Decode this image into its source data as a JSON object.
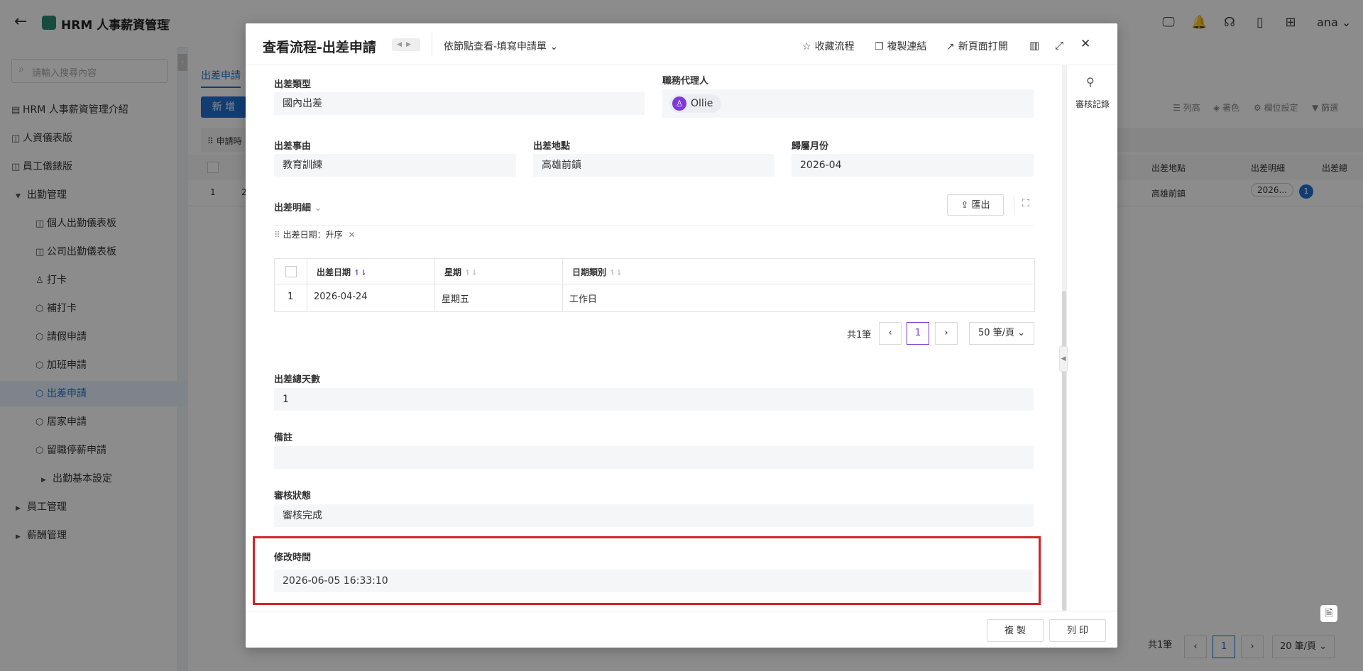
{
  "app": {
    "title": "HRM 人事薪資管理",
    "user": "ana"
  },
  "sidebar": {
    "search_placeholder": "請輸入搜尋內容",
    "items": [
      {
        "label": "HRM 人事薪資管理介紹"
      },
      {
        "label": "人資儀表版"
      },
      {
        "label": "員工儀錶版"
      },
      {
        "label": "出勤管理"
      },
      {
        "label": "個人出勤儀表板"
      },
      {
        "label": "公司出勤儀表板"
      },
      {
        "label": "打卡"
      },
      {
        "label": "補打卡"
      },
      {
        "label": "請假申請"
      },
      {
        "label": "加班申請"
      },
      {
        "label": "出差申請"
      },
      {
        "label": "居家申請"
      },
      {
        "label": "留職停薪申請"
      },
      {
        "label": "出勤基本設定"
      },
      {
        "label": "員工管理"
      },
      {
        "label": "薪酬管理"
      }
    ]
  },
  "background": {
    "tab": "出差申請",
    "new_button": "新 增",
    "tools": [
      "列高",
      "著色",
      "欄位設定",
      "篩選"
    ],
    "filter_label": "申請時",
    "columns": [
      "出差地點",
      "出差明細",
      "出差總"
    ],
    "row": {
      "index": "1",
      "index2": "2",
      "location": "高雄前鎮",
      "detail": "2026...",
      "count": "1"
    },
    "pager": {
      "total": "共1筆",
      "page": "1",
      "size": "20 筆/頁"
    }
  },
  "modal": {
    "title": "查看流程-出差申請",
    "view_mode": "依節點查看-填寫申請單",
    "actions": {
      "favorite": "收藏流程",
      "copy_link": "複製連結",
      "open_new": "新頁面打開"
    },
    "side": {
      "audit_log": "審核記錄"
    },
    "fields": {
      "trip_type": {
        "label": "出差類型",
        "value": "國內出差"
      },
      "agent": {
        "label": "職務代理人",
        "value": "Ollie"
      },
      "reason": {
        "label": "出差事由",
        "value": "教育訓練"
      },
      "location": {
        "label": "出差地點",
        "value": "高雄前鎮"
      },
      "month": {
        "label": "歸屬月份",
        "value": "2026-04"
      },
      "total_days": {
        "label": "出差總天數",
        "value": "1"
      },
      "remark": {
        "label": "備註",
        "value": ""
      },
      "status": {
        "label": "審核狀態",
        "value": "審核完成"
      },
      "modified": {
        "label": "修改時間",
        "value": "2026-06-05 16:33:10"
      }
    },
    "detail": {
      "label": "出差明細",
      "export": "匯出",
      "sort_chip": "出差日期：升序",
      "columns": [
        "出差日期",
        "星期",
        "日期類別"
      ],
      "rows": [
        {
          "index": "1",
          "date": "2026-04-24",
          "weekday": "星期五",
          "type": "工作日"
        }
      ],
      "pager": {
        "total": "共1筆",
        "page": "1",
        "size": "50 筆/頁"
      }
    },
    "footer": {
      "copy": "複 製",
      "print": "列 印"
    }
  }
}
